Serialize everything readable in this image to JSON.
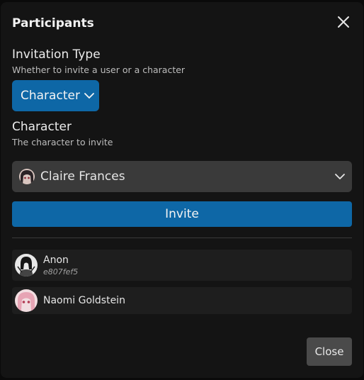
{
  "dialog": {
    "title": "Participants",
    "close_icon": "close-icon"
  },
  "invitation_type": {
    "label": "Invitation Type",
    "description": "Whether to invite a user or a character",
    "selected": "Character",
    "icon": "chevron-down-icon"
  },
  "character": {
    "label": "Character",
    "description": "The character to invite",
    "selected": "Claire Frances",
    "icon": "chevron-down-icon"
  },
  "invite_button": "Invite",
  "participants": [
    {
      "name": "Anon",
      "id": "e807fef5"
    },
    {
      "name": "Naomi Goldstein"
    }
  ],
  "close_button": "Close",
  "colors": {
    "accent": "#0e67a6",
    "background": "#141414",
    "row": "#1e1e1e"
  }
}
